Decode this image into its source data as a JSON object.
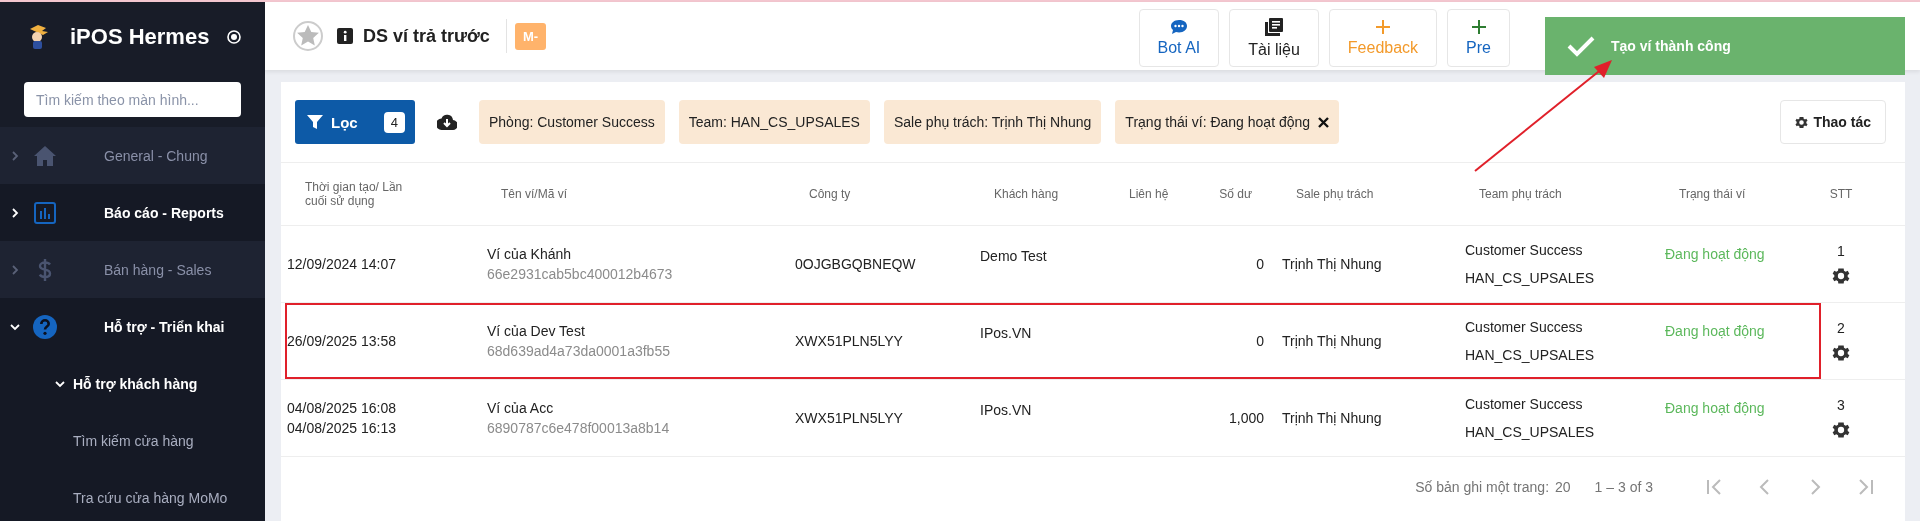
{
  "sidebar": {
    "brand": "iPOS Hermes",
    "search": {
      "placeholder": "Tìm kiếm theo màn hình..."
    },
    "items": [
      {
        "label": "General - Chung",
        "selected": false,
        "expanded": false
      },
      {
        "label": "Báo cáo - Reports",
        "selected": true,
        "expanded": false
      },
      {
        "label": "Bán hàng - Sales",
        "selected": false,
        "expanded": false
      },
      {
        "label": "Hỗ trợ - Triển khai",
        "selected": true,
        "expanded": true,
        "children": [
          {
            "label": "Hỗ trợ khách hàng",
            "selected": true,
            "expanded": true,
            "children": [
              {
                "label": "Tìm kiếm cửa hàng"
              },
              {
                "label": "Tra cứu cửa hàng MoMo"
              }
            ]
          }
        ]
      }
    ]
  },
  "header": {
    "title": "DS ví trả trước",
    "badge": "M-",
    "buttons": [
      {
        "label": "Bot AI",
        "kind": "bot"
      },
      {
        "label": "Tài liệu",
        "kind": "docs"
      },
      {
        "label": "Feedback",
        "kind": "feedback"
      },
      {
        "label": "Pre",
        "kind": "ticket"
      }
    ]
  },
  "toast": {
    "message": "Tạo ví thành công"
  },
  "toolbar": {
    "filter_button": {
      "label": "Lọc",
      "count": "4"
    },
    "chips": [
      {
        "label": "Phòng: Customer Success",
        "removable": false
      },
      {
        "label": "Team: HAN_CS_UPSALES",
        "removable": false
      },
      {
        "label": "Sale phụ trách: Trịnh Thị Nhung",
        "removable": false
      },
      {
        "label": "Trạng thái ví: Đang hoạt động",
        "removable": true
      }
    ],
    "actions_button": "Thao tác"
  },
  "table": {
    "columns": [
      "Thời gian tạo/ Lần cuối sử dụng",
      "Tên ví/Mã ví",
      "Công ty",
      "Khách hàng",
      "Liên hệ",
      "Số dư",
      "Sale phụ trách",
      "Team phụ trách",
      "Trạng thái ví",
      "STT"
    ],
    "rows": [
      {
        "times": [
          "12/09/2024 14:07"
        ],
        "wallet_name": "Ví của Khánh",
        "wallet_id": "66e2931cab5bc400012b4673",
        "company": "0OJGBGQBNEQW",
        "customer": "Demo Test",
        "balance": "0",
        "sale": "Trịnh Thị Nhung",
        "team": [
          "Customer Success",
          "HAN_CS_UPSALES"
        ],
        "status": "Đang hoạt động",
        "stt": "1",
        "highlighted": false
      },
      {
        "times": [
          "26/09/2025 13:58"
        ],
        "wallet_name": "Ví của Dev Test",
        "wallet_id": "68d639ad4a73da0001a3fb55",
        "company": "XWX51PLN5LYY",
        "customer": "IPos.VN",
        "balance": "0",
        "sale": "Trịnh Thị Nhung",
        "team": [
          "Customer Success",
          "HAN_CS_UPSALES"
        ],
        "status": "Đang hoạt động",
        "stt": "2",
        "highlighted": true
      },
      {
        "times": [
          "04/08/2025 16:08",
          "04/08/2025 16:13"
        ],
        "wallet_name": "Ví của Acc",
        "wallet_id": "6890787c6e478f00013a8b14",
        "company": "XWX51PLN5LYY",
        "customer": "IPos.VN",
        "balance": "1,000",
        "sale": "Trịnh Thị Nhung",
        "team": [
          "Customer Success",
          "HAN_CS_UPSALES"
        ],
        "status": "Đang hoạt động",
        "stt": "3",
        "highlighted": false
      }
    ]
  },
  "pagination": {
    "page_size_label": "Số bản ghi một trang:",
    "page_size": "20",
    "range": "1 – 3 of 3"
  }
}
